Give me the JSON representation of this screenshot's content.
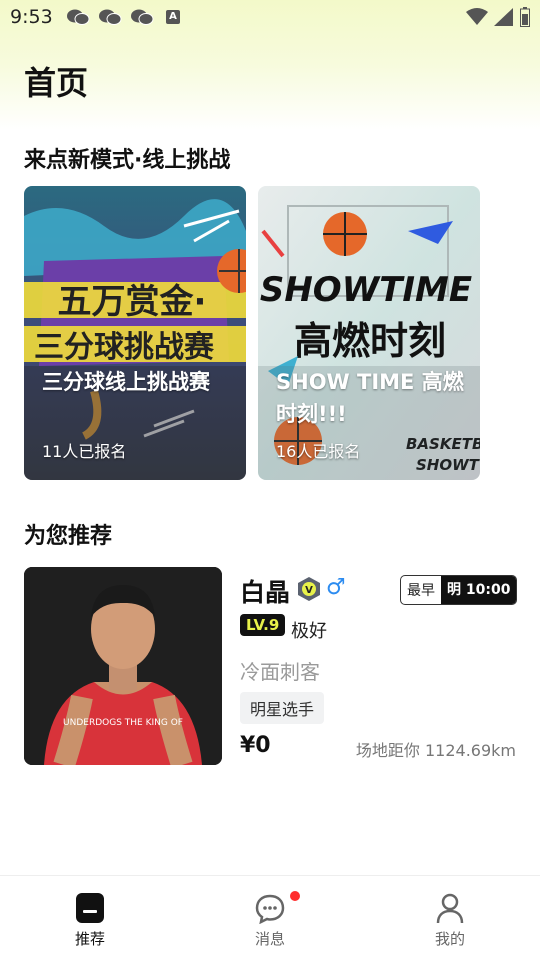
{
  "status_bar": {
    "time": "9:53",
    "icons_left": [
      "chat-icon",
      "chat-icon",
      "chat-icon",
      "a-icon"
    ],
    "icons_right": [
      "wifi-icon",
      "signal-icon",
      "battery-icon"
    ]
  },
  "page_title": "首页",
  "challenge_section": {
    "title": "来点新模式·线上挑战",
    "cards": [
      {
        "name": "三分球线上挑战赛",
        "count": "11人已报名",
        "banner_text": [
          "五万赏金·",
          "三分球挑战赛"
        ]
      },
      {
        "name": "SHOW TIME 高燃时刻!!!",
        "count": "16人已报名",
        "banner_text": [
          "SHOWTIME",
          "高燃时刻",
          "BASKETB",
          "SHOWT"
        ]
      }
    ]
  },
  "recommend_section": {
    "title": "为您推荐",
    "player": {
      "name": "白晶",
      "verified_badge": "V",
      "gender": "♂",
      "time_label": "最早",
      "time_value": "明 10:00",
      "level": "LV.9",
      "level_text": "极好",
      "nickname": "冷面刺客",
      "tag": "明星选手",
      "price": "¥0",
      "distance": "场地距你 1124.69km",
      "jersey_text": "UNDERDOGS THE KING OF"
    }
  },
  "bottom_nav": [
    {
      "label": "推荐",
      "icon": "recommend-icon",
      "active": true
    },
    {
      "label": "消息",
      "icon": "message-icon",
      "active": false
    },
    {
      "label": "我的",
      "icon": "profile-icon",
      "active": false
    }
  ],
  "colors": {
    "accent_level": "#e8f24a",
    "gender_blue": "#2d8cf0",
    "notify_red": "#ff2d2d"
  }
}
